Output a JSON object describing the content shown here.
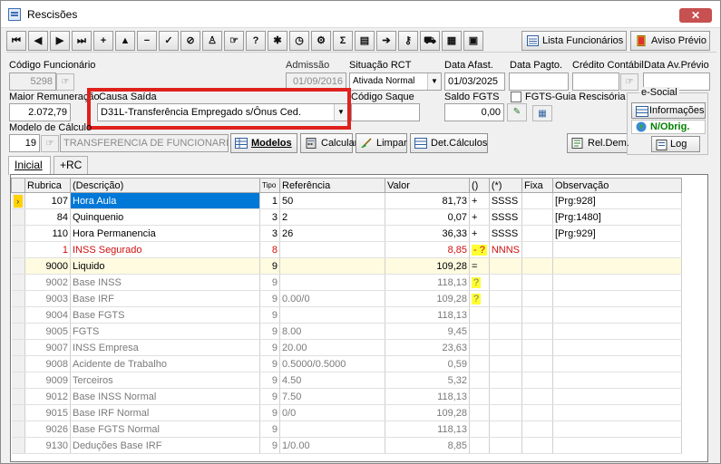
{
  "window": {
    "title": "Rescisões",
    "close_glyph": "✕"
  },
  "toolbar": {
    "buttons": [
      {
        "name": "first-record-button",
        "icon": "first-icon",
        "glyph": "⏮"
      },
      {
        "name": "prev-record-button",
        "icon": "prev-icon",
        "glyph": "◀"
      },
      {
        "name": "next-record-button",
        "icon": "next-icon",
        "glyph": "▶"
      },
      {
        "name": "last-record-button",
        "icon": "last-icon",
        "glyph": "⏭"
      },
      {
        "name": "insert-button",
        "icon": "plus-icon",
        "glyph": "+"
      },
      {
        "name": "edit-button",
        "icon": "triangle-up-icon",
        "glyph": "▲"
      },
      {
        "name": "delete-button",
        "icon": "minus-icon",
        "glyph": "−"
      },
      {
        "name": "confirm-button",
        "icon": "check-icon",
        "glyph": "✓"
      },
      {
        "name": "cancel-button",
        "icon": "cancel-icon",
        "glyph": "⊘"
      },
      {
        "name": "print-button",
        "icon": "printer-icon",
        "glyph": "♙"
      },
      {
        "name": "lookup-button",
        "icon": "hand-pointer-icon",
        "glyph": "☞"
      },
      {
        "name": "help-button",
        "icon": "help-icon",
        "glyph": "?"
      },
      {
        "name": "tools-button",
        "icon": "tools-icon",
        "glyph": "✱"
      },
      {
        "name": "clock-button",
        "icon": "clock-icon",
        "glyph": "◷"
      },
      {
        "name": "config-button",
        "icon": "config-icon",
        "glyph": "⚙"
      },
      {
        "name": "sum-button",
        "icon": "sigma-icon",
        "glyph": "Σ"
      },
      {
        "name": "report-button",
        "icon": "report-icon",
        "glyph": "▤"
      },
      {
        "name": "export-button",
        "icon": "export-icon",
        "glyph": "➔"
      },
      {
        "name": "key-button",
        "icon": "key-icon",
        "glyph": "⚷"
      },
      {
        "name": "truck-button",
        "icon": "truck-icon",
        "glyph": "⛟"
      },
      {
        "name": "calendar-button",
        "icon": "calendar-icon",
        "glyph": "▦"
      },
      {
        "name": "window-button",
        "icon": "window-icon",
        "glyph": "▣"
      }
    ],
    "lista_funcionarios": "Lista Funcionários",
    "aviso_previo": "Aviso Prévio"
  },
  "header": {
    "codigo_funcionario_label": "Código Funcionário",
    "codigo_funcionario": "5298",
    "admissao_label": "Admissão",
    "admissao": "01/09/2016",
    "situacao_label": "Situação RCT",
    "situacao": "Ativada Normal",
    "data_afast_label": "Data Afast.",
    "data_afast": "01/03/2025",
    "data_pagto_label": "Data Pagto.",
    "data_pagto": "",
    "credito_label": "Crédito Contábil",
    "credito": "",
    "data_av_label": "Data Av.Prévio",
    "data_av": "",
    "maior_remun_label": "Maior Remuneração",
    "maior_remun": "2.072,79",
    "causa_saida_label": "Causa Saída",
    "causa_saida": "D31L-Transferência Empregado s/Ônus Ced.",
    "codigo_saque_label": "Código Saque",
    "codigo_saque": "",
    "saldo_fgts_label": "Saldo FGTS",
    "saldo_fgts": "0,00",
    "fgts_guia_label": "FGTS-Guia Rescisória",
    "modelo_calc_label": "Modelo de Cálculo",
    "modelo_calc_code": "19",
    "modelo_calc_desc": "TRANSFERENCIA DE FUNCIONARIO"
  },
  "actions": {
    "modelos": "Modelos",
    "calcular": "Calcular",
    "limpar": "Limpar",
    "det_calculos": "Det.Cálculos",
    "rel_dem": "Rel.Dem."
  },
  "esocial": {
    "title": "e-Social",
    "informacoes": "Informações",
    "status": "N/Obrig.",
    "log": "Log"
  },
  "tabs": [
    "Inicial",
    "+RC"
  ],
  "grid": {
    "columns": [
      "Rubrica",
      "(Descrição)",
      "Tipo",
      "Referência",
      "Valor",
      "()",
      "(*)",
      "Fixa",
      "Observação"
    ],
    "rows": [
      {
        "rubrica": "107",
        "descricao": "Hora Aula",
        "tipo": "1",
        "referencia": "50",
        "valor": "81,73",
        "sinal": "+",
        "star": "SSSS",
        "fixa": "",
        "obs": "[Prg:928]",
        "style": "normal",
        "current": true
      },
      {
        "rubrica": "84",
        "descricao": "Quinquenio",
        "tipo": "3",
        "referencia": "2",
        "valor": "0,07",
        "sinal": "+",
        "star": "SSSS",
        "fixa": "",
        "obs": "[Prg:1480]",
        "style": "normal"
      },
      {
        "rubrica": "110",
        "descricao": "Hora Permanencia",
        "tipo": "3",
        "referencia": "26",
        "valor": "36,33",
        "sinal": "+",
        "star": "SSSS",
        "fixa": "",
        "obs": "[Prg:929]",
        "style": "normal"
      },
      {
        "rubrica": "1",
        "descricao": "INSS Segurado",
        "tipo": "8",
        "referencia": "",
        "valor": "8,85",
        "sinal": "- ?",
        "star": "NNNS",
        "fixa": "",
        "obs": "",
        "style": "red"
      },
      {
        "rubrica": "9000",
        "descricao": "Liquido",
        "tipo": "9",
        "referencia": "",
        "valor": "109,28",
        "sinal": "=",
        "star": "",
        "fixa": "",
        "obs": "",
        "style": "yellow"
      },
      {
        "rubrica": "9002",
        "descricao": "Base INSS",
        "tipo": "9",
        "referencia": "",
        "valor": "118,13",
        "sinal": "?",
        "star": "",
        "fixa": "",
        "obs": "",
        "style": "gray"
      },
      {
        "rubrica": "9003",
        "descricao": "Base IRF",
        "tipo": "9",
        "referencia": "0.00/0",
        "valor": "109,28",
        "sinal": "?",
        "star": "",
        "fixa": "",
        "obs": "",
        "style": "gray"
      },
      {
        "rubrica": "9004",
        "descricao": "Base FGTS",
        "tipo": "9",
        "referencia": "",
        "valor": "118,13",
        "sinal": "",
        "star": "",
        "fixa": "",
        "obs": "",
        "style": "gray"
      },
      {
        "rubrica": "9005",
        "descricao": "FGTS",
        "tipo": "9",
        "referencia": "8.00",
        "valor": "9,45",
        "sinal": "",
        "star": "",
        "fixa": "",
        "obs": "",
        "style": "gray"
      },
      {
        "rubrica": "9007",
        "descricao": "INSS Empresa",
        "tipo": "9",
        "referencia": "20.00",
        "valor": "23,63",
        "sinal": "",
        "star": "",
        "fixa": "",
        "obs": "",
        "style": "gray"
      },
      {
        "rubrica": "9008",
        "descricao": "Acidente de Trabalho",
        "tipo": "9",
        "referencia": "0.5000/0.5000",
        "valor": "0,59",
        "sinal": "",
        "star": "",
        "fixa": "",
        "obs": "",
        "style": "gray"
      },
      {
        "rubrica": "9009",
        "descricao": "Terceiros",
        "tipo": "9",
        "referencia": "4.50",
        "valor": "5,32",
        "sinal": "",
        "star": "",
        "fixa": "",
        "obs": "",
        "style": "gray"
      },
      {
        "rubrica": "9012",
        "descricao": "Base INSS Normal",
        "tipo": "9",
        "referencia": "7.50",
        "valor": "118,13",
        "sinal": "",
        "star": "",
        "fixa": "",
        "obs": "",
        "style": "gray"
      },
      {
        "rubrica": "9015",
        "descricao": "Base IRF Normal",
        "tipo": "9",
        "referencia": "0/0",
        "valor": "109,28",
        "sinal": "",
        "star": "",
        "fixa": "",
        "obs": "",
        "style": "gray"
      },
      {
        "rubrica": "9026",
        "descricao": "Base FGTS Normal",
        "tipo": "9",
        "referencia": "",
        "valor": "118,13",
        "sinal": "",
        "star": "",
        "fixa": "",
        "obs": "",
        "style": "gray"
      },
      {
        "rubrica": "9130",
        "descricao": "Deduções Base IRF",
        "tipo": "9",
        "referencia": "1/0.00",
        "valor": "8,85",
        "sinal": "",
        "star": "",
        "fixa": "",
        "obs": "",
        "style": "gray"
      }
    ]
  },
  "colors": {
    "highlight_box": "#e0201c",
    "selection": "#0078d7",
    "warn_row": "#d01010",
    "flag": "#ffff33",
    "current_marker": "#ffd200",
    "esocial_status": "#008000"
  }
}
